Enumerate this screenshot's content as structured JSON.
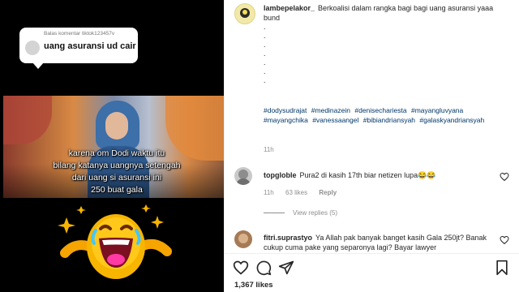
{
  "media": {
    "reply_header": "Balas komentar tiktok123457v",
    "reply_text": "uang asuransi ud cair",
    "caption_lines": [
      "karena om Dodi waktu itu",
      "bilang katanya uangnya setengah",
      "dari uang si asuransi ini",
      "250 buat gala"
    ],
    "sticker_icon": "laughing-emoji-icon"
  },
  "post": {
    "caption": {
      "username": "lambepelakor_",
      "text": "Berkoalisi dalam rangka bagi bagi uang asuransi yaaa bund",
      "dots": [
        ".",
        ".",
        ".",
        ".",
        ".",
        ".",
        "."
      ],
      "hashtags": [
        "#dodysudrajat",
        "#medinazein",
        "#denisechariesta",
        "#mayangluvyana",
        "#mayangchika",
        "#vanessaangel",
        "#bibiandriansyah",
        "#galaskyandriansyah"
      ],
      "time": "11h"
    },
    "comments": [
      {
        "username": "topgloble",
        "text": "Pura2 di kasih 17th biar netizen lupa😂😂",
        "time": "11h",
        "likes": "63 likes",
        "reply_label": "Reply",
        "view_replies": "View replies (5)"
      },
      {
        "username": "fitri.suprastyo",
        "text": "Ya Allah pak banyak banget kasih Gala 250jt? Banak cukup cuma pake yang separonya lagi? Bayar lawyer"
      }
    ],
    "actions": {
      "like_icon": "heart-icon",
      "comment_icon": "comment-icon",
      "share_icon": "share-icon",
      "save_icon": "bookmark-icon"
    },
    "likes_count": "1,367 likes"
  },
  "colors": {
    "hashtag": "#00376b",
    "muted": "#8e8e8e",
    "text": "#262626",
    "emoji_yellow": "#f7b500",
    "emoji_pink": "#ff3aa5"
  }
}
